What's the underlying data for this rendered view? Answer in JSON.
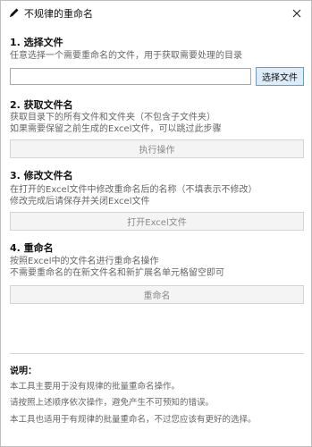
{
  "window": {
    "title": "不规律的重命名",
    "close_glyph": "✕",
    "title_icon": "pen-icon"
  },
  "steps": [
    {
      "title": "1. 选择文件",
      "desc": [
        "任意选择一个需要重命名的文件，用于获取需要处理的目录"
      ],
      "input_value": "",
      "button": "选择文件"
    },
    {
      "title": "2. 获取文件名",
      "desc": [
        "获取目录下的所有文件和文件夹（不包含子文件夹）",
        "如果需要保留之前生成的Excel文件，可以跳过此步骤"
      ],
      "button": "执行操作"
    },
    {
      "title": "3. 修改文件名",
      "desc": [
        "在打开的Excel文件中修改重命名后的名称（不填表示不修改）",
        "修改完成后请保存并关闭Excel文件"
      ],
      "button": "打开Excel文件"
    },
    {
      "title": "4. 重命名",
      "desc": [
        "按照Excel中的文件名进行重命名操作",
        "不需要重命名的在新文件名和新扩展名单元格留空即可"
      ],
      "button": "重命名"
    }
  ],
  "notes": {
    "title": "说明：",
    "lines": [
      "本工具主要用于没有规律的批量重命名操作。",
      "请按照上述顺序依次操作，避免产生不可预知的错误。",
      "本工具也适用于有规律的批量重命名，不过您应该有更好的选择。"
    ]
  }
}
